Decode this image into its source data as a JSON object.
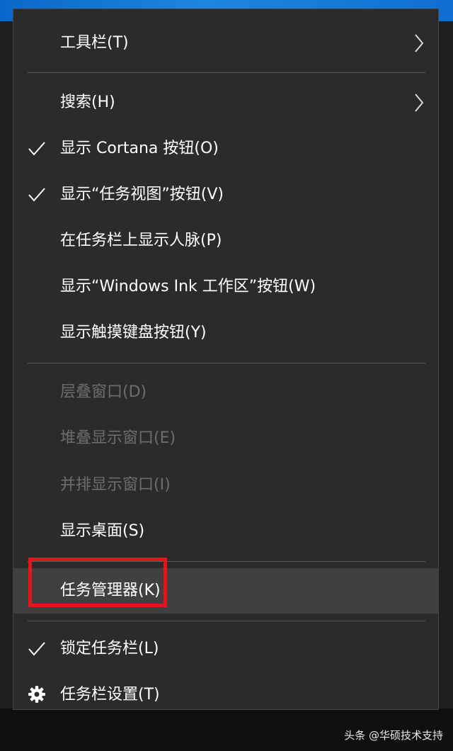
{
  "menu": {
    "items": [
      {
        "label": "工具栏(T)",
        "submenu": true
      },
      {
        "label": "搜索(H)",
        "submenu": true
      },
      {
        "label": "显示 Cortana 按钮(O)",
        "checked": true
      },
      {
        "label": "显示“任务视图”按钮(V)",
        "checked": true
      },
      {
        "label": "在任务栏上显示人脉(P)"
      },
      {
        "label": "显示“Windows Ink 工作区”按钮(W)"
      },
      {
        "label": "显示触摸键盘按钮(Y)"
      },
      {
        "label": "层叠窗口(D)",
        "disabled": true
      },
      {
        "label": "堆叠显示窗口(E)",
        "disabled": true
      },
      {
        "label": "并排显示窗口(I)",
        "disabled": true
      },
      {
        "label": "显示桌面(S)"
      },
      {
        "label": "任务管理器(K)",
        "highlighted": true
      },
      {
        "label": "锁定任务栏(L)",
        "checked": true
      },
      {
        "label": "任务栏设置(T)",
        "icon": "gear-icon"
      }
    ]
  },
  "annotation": {
    "color": "#e8141c",
    "target": "任务管理器(K)"
  },
  "watermark": "头条 @华硕技术支持",
  "colors": {
    "menu_bg": "#2b2b2b",
    "highlight_bg": "#404040",
    "disabled_text": "#6d6d6d",
    "separator": "#5a5a5a"
  }
}
